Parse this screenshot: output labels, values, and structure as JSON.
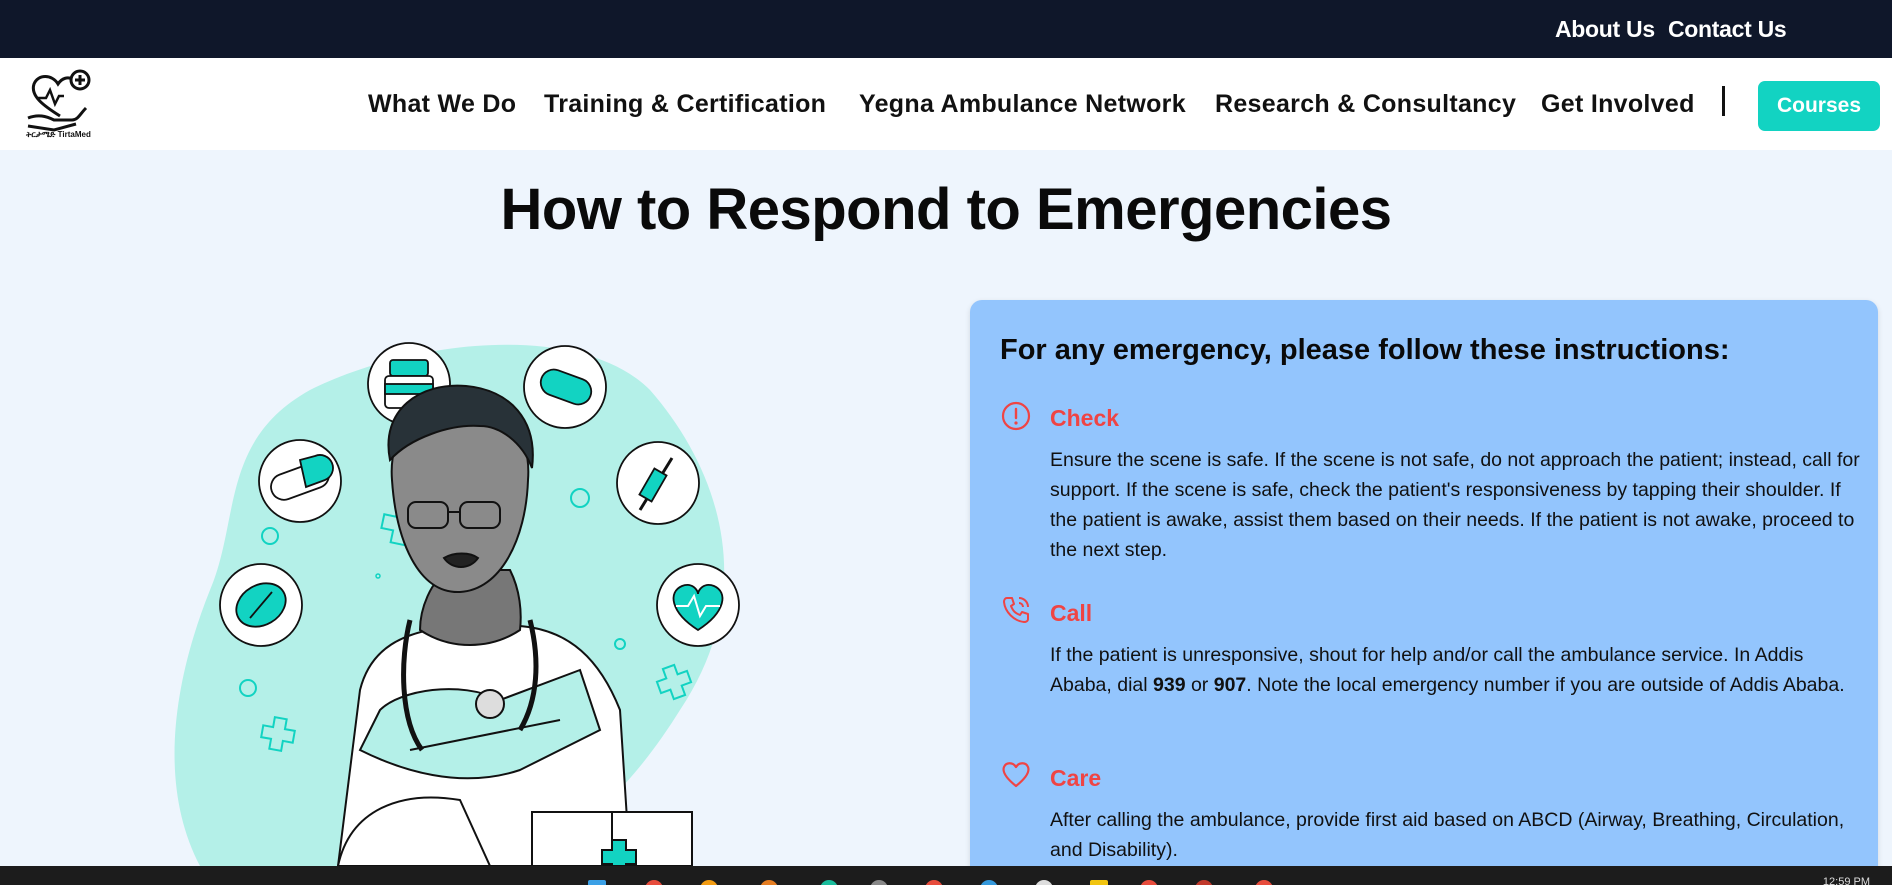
{
  "topbar": {
    "about": "About Us",
    "contact": "Contact Us"
  },
  "logo": {
    "text": "ትርታሜድ TirtaMed"
  },
  "nav": {
    "items": [
      "What We Do",
      "Training & Certification",
      "Yegna Ambulance Network",
      "Research & Consultancy",
      "Get Involved"
    ],
    "courses": "Courses"
  },
  "page": {
    "title": "How to Respond to Emergencies"
  },
  "card": {
    "heading": "For any emergency, please follow these instructions:",
    "steps": [
      {
        "icon": "alert-circle-icon",
        "title": "Check",
        "body": "Ensure the scene is safe. If the scene is not safe, do not approach the patient; instead, call for support. If the scene is safe, check the patient's responsiveness by tapping their shoulder. If the patient is awake, assist them based on their needs. If the patient is not awake, proceed to the next step."
      },
      {
        "icon": "phone-call-icon",
        "title": "Call",
        "body_before": "If the patient is unresponsive, shout for help and/or call the ambulance service. In Addis Ababa, dial ",
        "number1": "939",
        "connector": " or ",
        "number2": "907",
        "body_after": ". Note the local emergency number if you are outside of Addis Ababa."
      },
      {
        "icon": "heart-icon",
        "title": "Care",
        "body": "After calling the ambulance, provide first aid based on ABCD (Airway, Breathing, Circulation, and Disability)."
      }
    ]
  },
  "colors": {
    "topbar": "#0f172a",
    "accent": "#12d3c2",
    "card": "#93c5fd",
    "step_title": "#ef4444",
    "background": "#eef5fd"
  },
  "taskbar": {
    "clock": "12:59 PM"
  }
}
